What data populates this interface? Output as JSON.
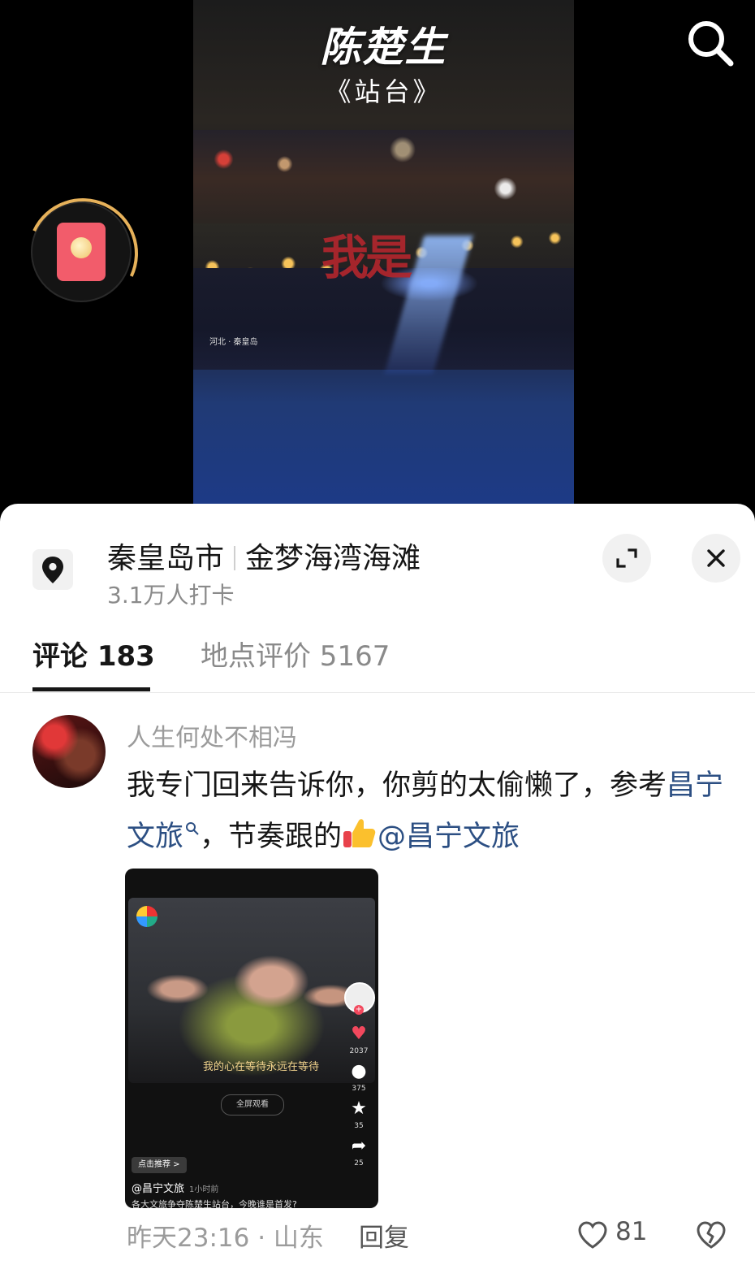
{
  "video": {
    "title": "陈楚生",
    "subtitle": "《站台》",
    "overlay_word": "我是",
    "location_tag": "河北 · 秦皇岛"
  },
  "location": {
    "city": "秦皇岛市",
    "spot": "金梦海湾海滩",
    "checkins": "3.1万人打卡"
  },
  "tabs": [
    {
      "label": "评论 183",
      "selected": true
    },
    {
      "label": "地点评价 5167",
      "selected": false
    }
  ],
  "comment": {
    "username": "人生何处不相冯",
    "text_1": "我专门回来告诉你，你剪的太偷懒了，参考",
    "link": "昌宁文旅",
    "text_2": "，节奏跟的",
    "mention": "@昌宁文旅",
    "time": "昨天23:16",
    "region": "山东",
    "separator": "·",
    "reply": "回复",
    "likes": "81"
  },
  "embedded_video": {
    "lyric": "我的心在等待永远在等待",
    "fullscreen": "全屏观看",
    "likes": "2037",
    "comments": "375",
    "favorites": "35",
    "shares": "25",
    "recommend": "点击推荐 >",
    "author": "@昌宁文旅",
    "time": "1小时前",
    "desc": "各大文旅争夺陈楚生站台，今晚谁是首发?"
  },
  "colors": {
    "link": "#2c4f83",
    "redpacket": "#f25c6b",
    "text_primary": "#161616",
    "text_secondary": "#9b9b9b"
  }
}
